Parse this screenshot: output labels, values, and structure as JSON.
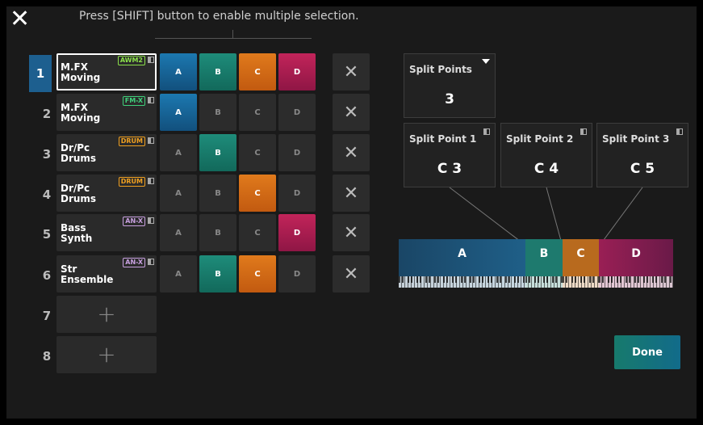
{
  "close_label": "✕",
  "hint": "Press [SHIFT] button to enable multiple selection.",
  "zone_labels": [
    "A",
    "B",
    "C",
    "D"
  ],
  "delete_label": "✕",
  "parts": [
    {
      "num": "1",
      "name1": "M.FX",
      "name2": "Moving",
      "badge": "AWM2",
      "badge_color": "#8be04a",
      "zones": [
        true,
        true,
        true,
        true
      ],
      "active": true
    },
    {
      "num": "2",
      "name1": "M.FX",
      "name2": "Moving",
      "badge": "FM-X",
      "badge_color": "#3fd07a",
      "zones": [
        true,
        false,
        false,
        false
      ],
      "active": false
    },
    {
      "num": "3",
      "name1": "Dr/Pc",
      "name2": "Drums",
      "badge": "DRUM",
      "badge_color": "#f0a020",
      "zones": [
        false,
        true,
        false,
        false
      ],
      "active": false
    },
    {
      "num": "4",
      "name1": "Dr/Pc",
      "name2": "Drums",
      "badge": "DRUM",
      "badge_color": "#f0a020",
      "zones": [
        false,
        false,
        true,
        false
      ],
      "active": false
    },
    {
      "num": "5",
      "name1": "Bass",
      "name2": "Synth",
      "badge": "AN-X",
      "badge_color": "#c8a0e0",
      "zones": [
        false,
        false,
        false,
        true
      ],
      "active": false
    },
    {
      "num": "6",
      "name1": "Str",
      "name2": "Ensemble",
      "badge": "AN-X",
      "badge_color": "#c8a0e0",
      "zones": [
        false,
        true,
        true,
        false
      ],
      "active": false
    }
  ],
  "empty_parts": [
    {
      "num": "7",
      "plus": "+"
    },
    {
      "num": "8",
      "plus": "+"
    }
  ],
  "split_points": {
    "label": "Split Points",
    "value": "3"
  },
  "split_point_items": [
    {
      "label": "Split Point 1",
      "value": "C 3"
    },
    {
      "label": "Split Point 2",
      "value": "C 4"
    },
    {
      "label": "Split Point 3",
      "value": "C 5"
    }
  ],
  "keyboard_zones": [
    {
      "label": "A",
      "color": "#1f5f88"
    },
    {
      "label": "B",
      "color": "#1e7a6e"
    },
    {
      "label": "C",
      "color": "#b86a1e"
    },
    {
      "label": "D",
      "color": "#9a1f55"
    }
  ],
  "done_label": "Done"
}
